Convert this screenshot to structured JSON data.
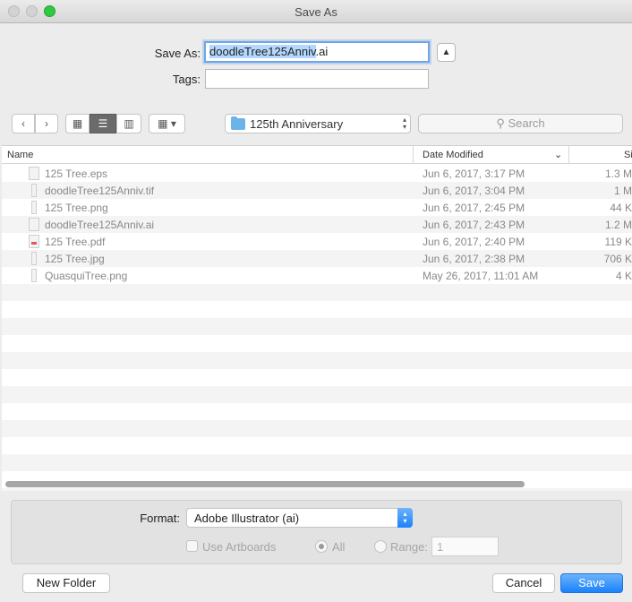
{
  "window": {
    "title": "Save As"
  },
  "save_as": {
    "label": "Save As:",
    "value_selected": "doodleTree125Anniv",
    "value_ext": ".ai"
  },
  "tags": {
    "label": "Tags:",
    "value": ""
  },
  "toolbar": {
    "back_icon": "chevron-left-icon",
    "forward_icon": "chevron-right-icon",
    "view_icon_icon": "grid-icon",
    "view_list_icon": "list-icon",
    "view_column_icon": "columns-icon",
    "group_icon": "arrange-icon",
    "location": "125th Anniversary",
    "search_placeholder": "Search"
  },
  "columns": {
    "name": "Name",
    "date": "Date Modified",
    "size": "Si"
  },
  "files": [
    {
      "name": "125 Tree.eps",
      "date": "Jun 6, 2017, 3:17 PM",
      "size": "1.3 M",
      "icon": "document-icon"
    },
    {
      "name": "doodleTree125Anniv.tif",
      "date": "Jun 6, 2017, 3:04 PM",
      "size": "1 M",
      "icon": "image-file-icon"
    },
    {
      "name": "125 Tree.png",
      "date": "Jun 6, 2017, 2:45 PM",
      "size": "44 K",
      "icon": "image-file-icon"
    },
    {
      "name": "doodleTree125Anniv.ai",
      "date": "Jun 6, 2017, 2:43 PM",
      "size": "1.2 M",
      "icon": "document-icon"
    },
    {
      "name": "125 Tree.pdf",
      "date": "Jun 6, 2017, 2:40 PM",
      "size": "119 K",
      "icon": "pdf-file-icon"
    },
    {
      "name": "125 Tree.jpg",
      "date": "Jun 6, 2017, 2:38 PM",
      "size": "706 K",
      "icon": "image-file-icon"
    },
    {
      "name": "QuasquiTree.png",
      "date": "May 26, 2017, 11:01 AM",
      "size": "4 K",
      "icon": "image-file-icon"
    }
  ],
  "format": {
    "label": "Format:",
    "value": "Adobe Illustrator (ai)"
  },
  "options": {
    "use_artboards": "Use Artboards",
    "all": "All",
    "range": "Range:",
    "range_value": "1"
  },
  "buttons": {
    "new_folder": "New Folder",
    "cancel": "Cancel",
    "save": "Save"
  },
  "colors": {
    "accent": "#1a82fb",
    "zoom_green": "#2fc840",
    "folder_blue": "#6ab4ea"
  }
}
